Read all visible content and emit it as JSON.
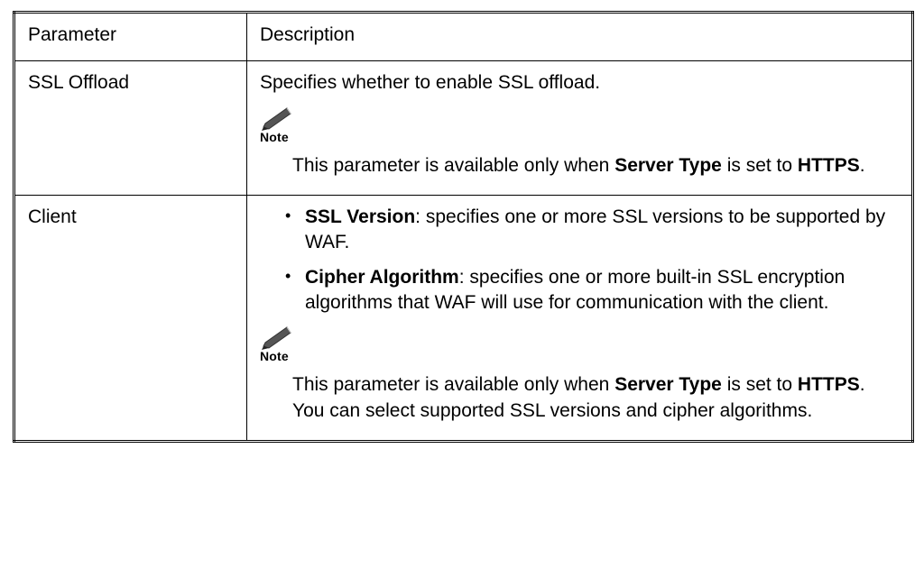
{
  "table": {
    "headers": {
      "param": "Parameter",
      "desc": "Description"
    },
    "rows": {
      "ssl_offload": {
        "param": "SSL Offload",
        "desc_intro": "Specifies whether to enable SSL offload.",
        "note_label": "Note",
        "note_pre": "This parameter is available only when ",
        "note_bold1": "Server Type",
        "note_mid": " is set to ",
        "note_bold2": "HTTPS",
        "note_post": "."
      },
      "client": {
        "param": "Client",
        "bullet1_bold": "SSL Version",
        "bullet1_rest": ": specifies one or more SSL versions to be supported by WAF.",
        "bullet2_bold": "Cipher Algorithm",
        "bullet2_rest": ": specifies one or more built-in SSL encryption algorithms that WAF will use for communication with the client.",
        "note_label": "Note",
        "note_pre": "This parameter is available only when ",
        "note_bold1": "Server Type",
        "note_mid": " is set to ",
        "note_bold2": "HTTPS",
        "note_post": ". You can select supported SSL versions and cipher algorithms."
      }
    }
  }
}
